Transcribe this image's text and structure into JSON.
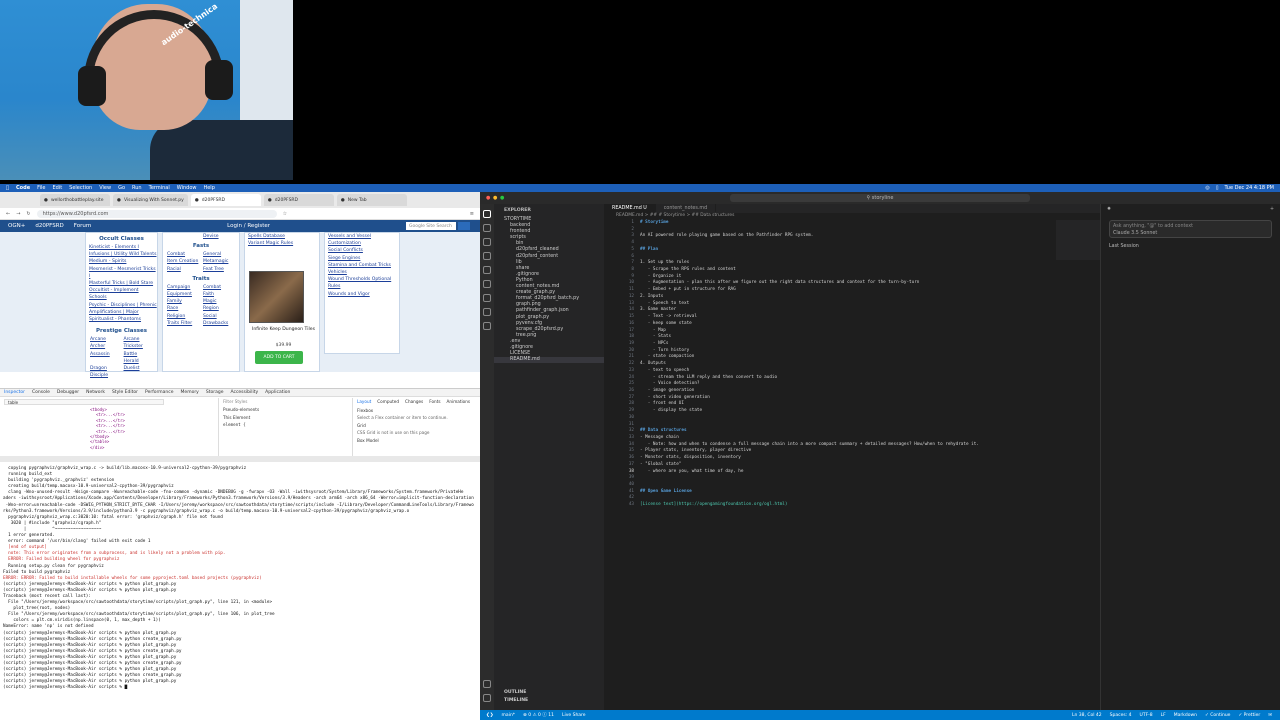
{
  "webcam": {
    "headphone_brand": "audio-technica"
  },
  "menubar": {
    "apple": "",
    "items": [
      "Code",
      "File",
      "Edit",
      "Selection",
      "View",
      "Go",
      "Run",
      "Terminal",
      "Window",
      "Help"
    ],
    "clock": "Tue Dec 24  4:18 PM"
  },
  "browser": {
    "tabs": [
      "wellorthobattleplay.site",
      "Visualizing With Sonnet.py",
      "d20PFSRD",
      "d20PFSRD",
      "New Tab"
    ],
    "url": "https://www.d20pfsrd.com",
    "site": {
      "nav": [
        "OGN+",
        "d20PFSRD",
        "Forum"
      ],
      "login": "Login / Register",
      "search_placeholder": "Google Site Search",
      "occult_title": "Occult Classes",
      "occult": [
        "Kineticist - Elements I",
        "Infusions | Utility Wild Talents",
        "Medium - Spirits",
        "Mesmerist - Mesmerist Tricks I",
        "Masterful Tricks | Bold Stare",
        "Occultist - Implement Schools",
        "Psychic - Disciplines | Phrenic",
        "Amplifications | Major",
        "Spiritualist - Phantoms"
      ],
      "prestige_title": "Prestige Classes",
      "prestige": [
        "Arcane Archer",
        "Arcane Trickster",
        "Assassin",
        "Battle Herald",
        "Dragon Disciple",
        "Duelist"
      ],
      "top_partial": "Devise",
      "fasts_title": "Fasts",
      "fasts": [
        "Combat",
        "General",
        "Item Creation",
        "Metamagic",
        "Racial",
        "Feat Tree"
      ],
      "traits_title": "Traits",
      "traits": [
        "Campaign",
        "Combat",
        "Equipment",
        "Faith",
        "Family",
        "Magic",
        "Race",
        "Region",
        "Religion",
        "Social",
        "Traits Filter",
        "Drawbacks"
      ],
      "spells": [
        "Spells Database",
        "Variant Magic Rules"
      ],
      "product_name": "Infinite Keep Dungeon Tiles",
      "product_price": "$39.99",
      "add_to_cart": "ADD TO CART",
      "rules": [
        "Vessels and Vessel",
        "Customization",
        "Social Conflicts",
        "Siege Engines",
        "Stamina and Combat Tricks",
        "Vehicles",
        "Wound Thresholds Optional Rules",
        "Wounds and Vigor"
      ]
    }
  },
  "devtools": {
    "tabs": [
      "Inspector",
      "Console",
      "Debugger",
      "Network",
      "Style Editor",
      "Performance",
      "Memory",
      "Storage",
      "Accessibility",
      "Application"
    ],
    "search": "table",
    "html_lines": [
      "<tbody>",
      "<tr>...</tr>",
      "<tr>...</tr>",
      "<tr>...</tr>",
      "<tr>...</tr>",
      "</tbody>",
      "</table>",
      "</div>"
    ],
    "rules_tabs": [
      "Layout",
      "Computed",
      "Changes",
      "Fonts",
      "Animations"
    ],
    "filter_placeholder": "Filter Styles",
    "pseudo": "Pseudo-elements",
    "this_element": "This Element",
    "element_rule": "element {",
    "flexbox": "Flexbox",
    "flex_hint": "Select a Flex container or item to continue.",
    "grid": "Grid",
    "grid_hint": "CSS Grid is not in use on this page",
    "box_model": "Box Model"
  },
  "terminal": {
    "lines": [
      {
        "t": "  copying pygraphviz/graphviz_wrap.c -> build/lib.macosx-10.9-universal2-cpython-39/pygraphviz",
        "e": false
      },
      {
        "t": "  running build_ext",
        "e": false
      },
      {
        "t": "  building 'pygraphviz._graphviz' extension",
        "e": false
      },
      {
        "t": "  creating build/temp.macosx-10.9-universal2-cpython-39/pygraphviz",
        "e": false
      },
      {
        "t": "  clang -Wno-unused-result -Wsign-compare -Wunreachable-code -fno-common -dynamic -DNDEBUG -g -fwrapv -O3 -Wall -iwithsysroot/System/Library/Frameworks/System.framework/PrivateHe",
        "e": false
      },
      {
        "t": "aders -iwithsysroot/Applications/Xcode.app/Contents/Developer/Library/Frameworks/Python3.framework/Versions/3.9/Headers -arch arm64 -arch x86_64 -Werror=implicit-function-declaration",
        "e": false
      },
      {
        "t": " -Wno-error=unreachable-code -DSWIG_PYTHON_STRICT_BYTE_CHAR -I/Users/jeremy/workspace/src/sawtoothdata/storytime/scripts/include -I/Library/Developer/CommandLineTools/Library/Framewo",
        "e": false
      },
      {
        "t": "rks/Python3.framework/Versions/3.9/include/python3.9 -c pygraphviz/graphviz_wrap.c -o build/temp.macosx-10.9-universal2-cpython-39/pygraphviz/graphviz_wrap.o",
        "e": false
      },
      {
        "t": "  pygraphviz/graphviz_wrap.c:3020:10: fatal error: 'graphviz/cgraph.h' file not found",
        "e": false
      },
      {
        "t": "   3020 | #include \"graphviz/cgraph.h\"",
        "e": false
      },
      {
        "t": "        |          ^~~~~~~~~~~~~~~~~~~",
        "e": false
      },
      {
        "t": "  1 error generated.",
        "e": false
      },
      {
        "t": "  error: command '/usr/bin/clang' failed with exit code 1",
        "e": false
      },
      {
        "t": "  [end of output]",
        "e": true
      },
      {
        "t": "",
        "e": false
      },
      {
        "t": "  note: This error originates from a subprocess, and is likely not a problem with pip.",
        "e": true
      },
      {
        "t": "  ERROR: Failed building wheel for pygraphviz",
        "e": true
      },
      {
        "t": "  Running setup.py clean for pygraphviz",
        "e": false
      },
      {
        "t": "Failed to build pygraphviz",
        "e": false
      },
      {
        "t": "ERROR: ERROR: Failed to build installable wheels for some pyproject.toml based projects (pygraphviz)",
        "e": true
      },
      {
        "t": "(scripts) jeremy@Jeremys-MacBook-Air scripts % python plot_graph.py",
        "e": false
      },
      {
        "t": "(scripts) jeremy@Jeremys-MacBook-Air scripts % python plot_graph.py",
        "e": false
      },
      {
        "t": "Traceback (most recent call last):",
        "e": false
      },
      {
        "t": "  File \"/Users/jeremy/workspace/src/sawtoothdata/storytime/scripts/plot_graph.py\", line 121, in <module>",
        "e": false
      },
      {
        "t": "    plot_tree(root, nodes)",
        "e": false
      },
      {
        "t": "  File \"/Users/jeremy/workspace/src/sawtoothdata/storytime/scripts/plot_graph.py\", line 106, in plot_tree",
        "e": false
      },
      {
        "t": "    colors = plt.cm.viridis(np.linspace(0, 1, max_depth + 1))",
        "e": false
      },
      {
        "t": "NameError: name 'np' is not defined",
        "e": false
      },
      {
        "t": "(scripts) jeremy@Jeremys-MacBook-Air scripts % python plot_graph.py",
        "e": false
      },
      {
        "t": "(scripts) jeremy@Jeremys-MacBook-Air scripts % python create_graph.py",
        "e": false
      },
      {
        "t": "(scripts) jeremy@Jeremys-MacBook-Air scripts % python plot_graph.py",
        "e": false
      },
      {
        "t": "(scripts) jeremy@Jeremys-MacBook-Air scripts % python create_graph.py",
        "e": false
      },
      {
        "t": "(scripts) jeremy@Jeremys-MacBook-Air scripts % python plot_graph.py",
        "e": false
      },
      {
        "t": "(scripts) jeremy@Jeremys-MacBook-Air scripts % python create_graph.py",
        "e": false
      },
      {
        "t": "(scripts) jeremy@Jeremys-MacBook-Air scripts % python plot_graph.py",
        "e": false
      },
      {
        "t": "(scripts) jeremy@Jeremys-MacBook-Air scripts % python create_graph.py",
        "e": false
      },
      {
        "t": "(scripts) jeremy@Jeremys-MacBook-Air scripts % python plot_graph.py",
        "e": false
      },
      {
        "t": "(scripts) jeremy@Jeremys-MacBook-Air scripts % ▇",
        "e": false
      }
    ]
  },
  "vscode": {
    "search": "storyline",
    "explorer_title": "EXPLORER",
    "files": [
      {
        "name": "STORYTIME",
        "d": 0,
        "sel": false
      },
      {
        "name": "backend",
        "d": 1,
        "sel": false
      },
      {
        "name": "frontend",
        "d": 1,
        "sel": false
      },
      {
        "name": "scripts",
        "d": 1,
        "sel": false
      },
      {
        "name": "bin",
        "d": 2,
        "sel": false
      },
      {
        "name": "d20pfsrd_cleaned",
        "d": 2,
        "sel": false
      },
      {
        "name": "d20pfsrd_content",
        "d": 2,
        "sel": false
      },
      {
        "name": "lib",
        "d": 2,
        "sel": false
      },
      {
        "name": "share",
        "d": 2,
        "sel": false
      },
      {
        "name": ".gitignore",
        "d": 2,
        "sel": false
      },
      {
        "name": "Python",
        "d": 2,
        "sel": false
      },
      {
        "name": "content_notes.md",
        "d": 2,
        "sel": false
      },
      {
        "name": "create_graph.py",
        "d": 2,
        "sel": false
      },
      {
        "name": "format_d20pfsrd_batch.py",
        "d": 2,
        "sel": false
      },
      {
        "name": "graph.png",
        "d": 2,
        "sel": false
      },
      {
        "name": "pathfinder_graph.json",
        "d": 2,
        "sel": false
      },
      {
        "name": "plot_graph.py",
        "d": 2,
        "sel": false
      },
      {
        "name": "pyvenv.cfg",
        "d": 2,
        "sel": false
      },
      {
        "name": "scrape_d20pfsrd.py",
        "d": 2,
        "sel": false
      },
      {
        "name": "tree.png",
        "d": 2,
        "sel": false
      },
      {
        "name": ".env",
        "d": 1,
        "sel": false
      },
      {
        "name": ".gitignore",
        "d": 1,
        "sel": false
      },
      {
        "name": "LICENSE",
        "d": 1,
        "sel": false
      },
      {
        "name": "README.md",
        "d": 1,
        "sel": true
      }
    ],
    "outline": "OUTLINE",
    "timeline": "TIMELINE",
    "tabs": [
      "README.md U",
      "content_notes.md"
    ],
    "breadcrumb": "README.md > ## # Storytime > ## Data structures",
    "code": [
      {
        "n": "1",
        "t": "# Storytime",
        "c": "h"
      },
      {
        "n": "2",
        "t": "",
        "c": ""
      },
      {
        "n": "3",
        "t": "An AI powered role playing game based on the Pathfinder RPG system.",
        "c": ""
      },
      {
        "n": "4",
        "t": "",
        "c": ""
      },
      {
        "n": "5",
        "t": "## Plan",
        "c": "h"
      },
      {
        "n": "6",
        "t": "",
        "c": ""
      },
      {
        "n": "7",
        "t": "1. Set up the rules",
        "c": ""
      },
      {
        "n": "8",
        "t": "   - Scrape the RPG rules and content",
        "c": ""
      },
      {
        "n": "9",
        "t": "   - Organize it",
        "c": ""
      },
      {
        "n": "10",
        "t": "   - Augmentation - plan this after we figure out the right data structures and context for the turn-by-turn",
        "c": ""
      },
      {
        "n": "11",
        "t": "   - Embed + put in structure for RAG",
        "c": ""
      },
      {
        "n": "12",
        "t": "2. Inputs",
        "c": ""
      },
      {
        "n": "13",
        "t": "   - Speech to text",
        "c": ""
      },
      {
        "n": "14",
        "t": "3. Game master",
        "c": ""
      },
      {
        "n": "15",
        "t": "   - Text -> retrieval",
        "c": ""
      },
      {
        "n": "16",
        "t": "   - keep some state",
        "c": ""
      },
      {
        "n": "17",
        "t": "     - Map",
        "c": ""
      },
      {
        "n": "18",
        "t": "     - Stats",
        "c": ""
      },
      {
        "n": "19",
        "t": "     - NPCs",
        "c": ""
      },
      {
        "n": "20",
        "t": "     - Turn history",
        "c": ""
      },
      {
        "n": "21",
        "t": "   - state compaction",
        "c": ""
      },
      {
        "n": "22",
        "t": "4. Outputs",
        "c": ""
      },
      {
        "n": "23",
        "t": "   - text to speech",
        "c": ""
      },
      {
        "n": "24",
        "t": "     - stream the LLM reply and then convert to audio",
        "c": ""
      },
      {
        "n": "25",
        "t": "     - Voice detection?",
        "c": ""
      },
      {
        "n": "26",
        "t": "   - image generation",
        "c": ""
      },
      {
        "n": "27",
        "t": "   - short video generation",
        "c": ""
      },
      {
        "n": "28",
        "t": "   - front end UI",
        "c": ""
      },
      {
        "n": "29",
        "t": "     - display the state",
        "c": ""
      },
      {
        "n": "30",
        "t": "",
        "c": ""
      },
      {
        "n": "31",
        "t": "",
        "c": ""
      },
      {
        "n": "32",
        "t": "## Data structures",
        "c": "h"
      },
      {
        "n": "33",
        "t": "- Message chain",
        "c": ""
      },
      {
        "n": "34",
        "t": "   - Note: how and when to condense a full message chain into a more compact summary + detailed messages? How/when to rehydrate it.",
        "c": ""
      },
      {
        "n": "35",
        "t": "- Player stats, inventory, player directive",
        "c": ""
      },
      {
        "n": "36",
        "t": "- Monster stats, disposition, inventory",
        "c": ""
      },
      {
        "n": "37",
        "t": "- \"Global state\"",
        "c": ""
      },
      {
        "n": "38",
        "t": "   - where are you, what time of day, he",
        "c": "cur"
      },
      {
        "n": "39",
        "t": "",
        "c": ""
      },
      {
        "n": "40",
        "t": "",
        "c": ""
      },
      {
        "n": "41",
        "t": "## Open Game License",
        "c": "h"
      },
      {
        "n": "42",
        "t": "",
        "c": ""
      },
      {
        "n": "43",
        "t": "[License text](https://opengamingfoundation.org/ogl.html)",
        "c": "link"
      }
    ],
    "chat": {
      "placeholder": "Ask anything, \"@\" to add context",
      "model": "Claude 3.5 Sonnet",
      "last_session": "Last Session"
    },
    "status": {
      "branch": "main*",
      "problems": "⊗ 0 ⚠ 0  ⓘ 11",
      "live": "Live Share",
      "position": "Ln 38, Col 42",
      "spaces": "Spaces: 4",
      "encoding": "UTF-8",
      "eol": "LF",
      "language": "Markdown",
      "continue": "✓ Continue",
      "prettier": "✓ Prettier"
    }
  },
  "colors": {
    "vscode_accent": "#007acc",
    "site_nav": "#1f4f8c",
    "add_cart": "#3cb54a",
    "menubar": "#1d5fb8"
  }
}
